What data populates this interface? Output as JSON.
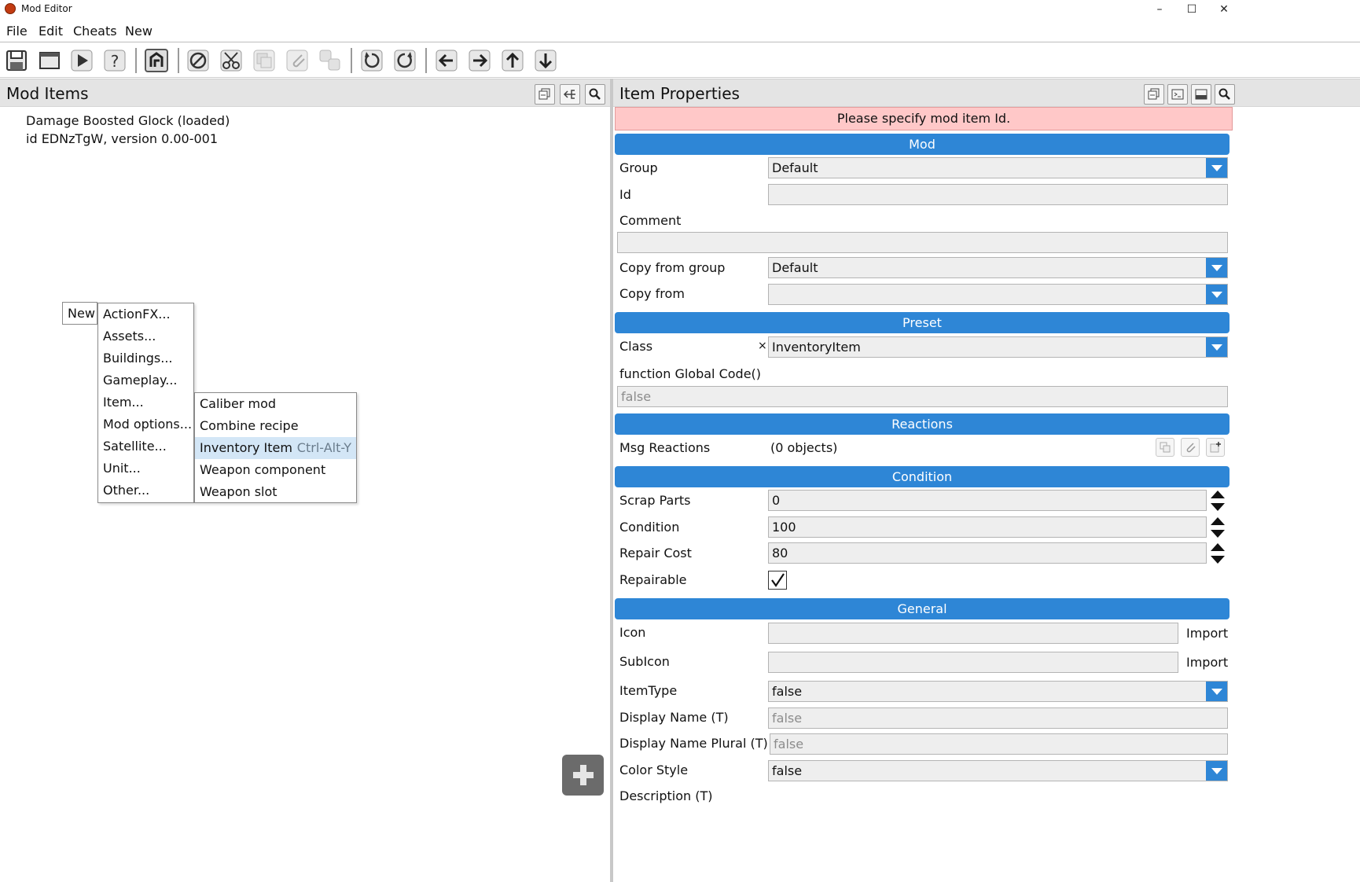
{
  "window": {
    "title": "Mod Editor",
    "minimize": "–",
    "maximize": "☐",
    "close": "✕"
  },
  "menubar": {
    "file": "File",
    "edit": "Edit",
    "cheats": "Cheats",
    "new": "New"
  },
  "toolbar": {
    "icons": [
      "save-icon",
      "window-icon",
      "play-icon",
      "help-icon",
      "test-mod-icon",
      "disable-icon",
      "cut-icon",
      "copy-icon",
      "paste-icon",
      "duplicate-icon",
      "undo-icon",
      "redo-icon",
      "arrow-left-icon",
      "arrow-right-icon",
      "arrow-up-icon",
      "arrow-down-icon"
    ]
  },
  "left_pane": {
    "title": "Mod Items",
    "mod_name": "Damage Boosted Glock (loaded)",
    "mod_id_line": "id EDNzTgW, version 0.00-001"
  },
  "context_menu": {
    "new_label": "New",
    "items": [
      "ActionFX...",
      "Assets...",
      "Buildings...",
      "Gameplay...",
      "Item...",
      "Mod options...",
      "Satellite...",
      "Unit...",
      "Other..."
    ],
    "submenu": [
      "Caliber mod",
      "Combine recipe",
      "Inventory Item",
      "Weapon component",
      "Weapon slot"
    ],
    "highlighted_shortcut": "Ctrl-Alt-Y"
  },
  "right_pane": {
    "title": "Item Properties",
    "error": "Please specify mod item Id.",
    "sections": {
      "mod": "Mod",
      "preset": "Preset",
      "reactions": "Reactions",
      "condition": "Condition",
      "general": "General"
    },
    "labels": {
      "group": "Group",
      "id": "Id",
      "comment": "Comment",
      "copy_from_group": "Copy from group",
      "copy_from": "Copy from",
      "class": "Class",
      "global_code": "function Global Code()",
      "msg_reactions": "Msg Reactions",
      "scrap_parts": "Scrap Parts",
      "condition": "Condition",
      "repair_cost": "Repair Cost",
      "repairable": "Repairable",
      "icon": "Icon",
      "subicon": "SubIcon",
      "item_type": "ItemType",
      "display_name": "Display Name (T)",
      "display_name_plural": "Display Name Plural (T)",
      "color_style": "Color Style",
      "description": "Description (T)"
    },
    "values": {
      "group": "Default",
      "id": "",
      "comment": "",
      "copy_from_group": "Default",
      "copy_from": "",
      "class_clear": "×",
      "class": "InventoryItem",
      "global_code": "false",
      "msg_reactions": "(0 objects)",
      "scrap_parts": "0",
      "condition": "100",
      "repair_cost": "80",
      "repairable": true,
      "icon": "",
      "subicon": "",
      "import": "Import",
      "item_type": "false",
      "display_name": "false",
      "display_name_plural": "false",
      "color_style": "false"
    }
  },
  "colors": {
    "accent": "#2e86d6",
    "error_bg": "#ffc8c8",
    "highlight": "#d3e6f6"
  }
}
